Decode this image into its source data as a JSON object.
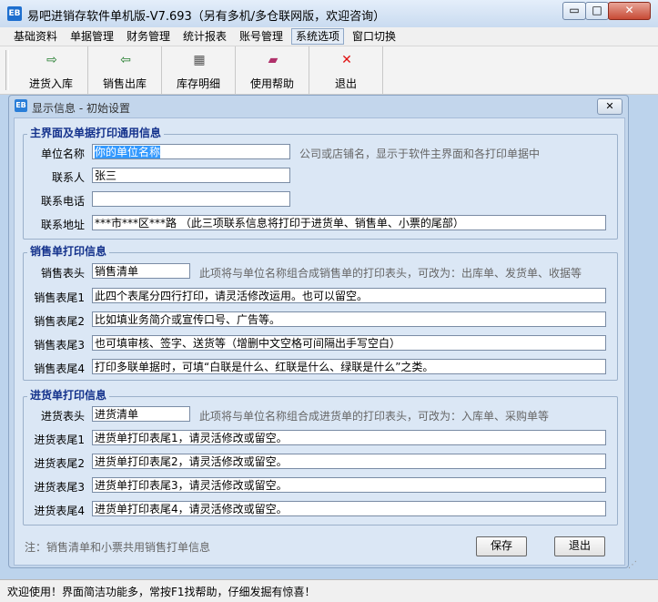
{
  "window": {
    "title": "易吧进销存软件单机版-V7.693（另有多机/多仓联网版，欢迎咨询）",
    "icon_text": "EB",
    "min_symbol": "▭",
    "max_symbol": "□",
    "close_symbol": "✕"
  },
  "menu": [
    "基础资料",
    "单据管理",
    "财务管理",
    "统计报表",
    "账号管理",
    "系统选项",
    "窗口切换"
  ],
  "menu_active_index": 5,
  "toolbar": [
    {
      "label": "进货入库",
      "icon": "stock-in-icon",
      "glyph": "⇨"
    },
    {
      "label": "销售出库",
      "icon": "stock-out-icon",
      "glyph": "⇦"
    },
    {
      "label": "库存明细",
      "icon": "inventory-icon",
      "glyph": "▦"
    },
    {
      "label": "使用帮助",
      "icon": "help-book-icon",
      "glyph": "▰"
    },
    {
      "label": "退出",
      "icon": "exit-x-icon",
      "glyph": "✕"
    }
  ],
  "dialog": {
    "title": "显示信息 - 初始设置",
    "icon_text": "EB",
    "close_symbol": "✕",
    "groups": {
      "general": {
        "title": "主界面及单据打印通用信息",
        "company_label": "单位名称",
        "company_value": "你的单位名称",
        "company_hint": "公司或店铺名，显示于软件主界面和各打印单据中",
        "contact_label": "联系人",
        "contact_value": "张三",
        "phone_label": "联系电话",
        "phone_value": "",
        "address_label": "联系地址",
        "address_value": "***市***区***路  （此三项联系信息将打印于进货单、销售单、小票的尾部）"
      },
      "sales": {
        "title": "销售单打印信息",
        "header_label": "销售表头",
        "header_value": "销售清单",
        "header_hint": "此项将与单位名称组合成销售单的打印表头，可改为：出库单、发货单、收据等",
        "footers": [
          {
            "label": "销售表尾1",
            "value": "此四个表尾分四行打印，请灵活修改运用。也可以留空。"
          },
          {
            "label": "销售表尾2",
            "value": "比如填业务简介或宣传口号、广告等。"
          },
          {
            "label": "销售表尾3",
            "value": "也可填审核、签字、送货等（增删中文空格可间隔出手写空白）"
          },
          {
            "label": "销售表尾4",
            "value": "打印多联单据时，可填“白联是什么、红联是什么、绿联是什么”之类。"
          }
        ]
      },
      "purchase": {
        "title": "进货单打印信息",
        "header_label": "进货表头",
        "header_value": "进货清单",
        "header_hint": "此项将与单位名称组合成进货单的打印表头，可改为：入库单、采购单等",
        "footers": [
          {
            "label": "进货表尾1",
            "value": "进货单打印表尾1，请灵活修改或留空。"
          },
          {
            "label": "进货表尾2",
            "value": "进货单打印表尾2，请灵活修改或留空。"
          },
          {
            "label": "进货表尾3",
            "value": "进货单打印表尾3，请灵活修改或留空。"
          },
          {
            "label": "进货表尾4",
            "value": "进货单打印表尾4，请灵活修改或留空。"
          }
        ]
      }
    },
    "note": "注：销售清单和小票共用销售打单信息",
    "save_label": "保存",
    "exit_label": "退出"
  },
  "status": "欢迎使用！界面简洁功能多，常按F1找帮助，仔细发掘有惊喜！",
  "grip_symbol": "⋰"
}
